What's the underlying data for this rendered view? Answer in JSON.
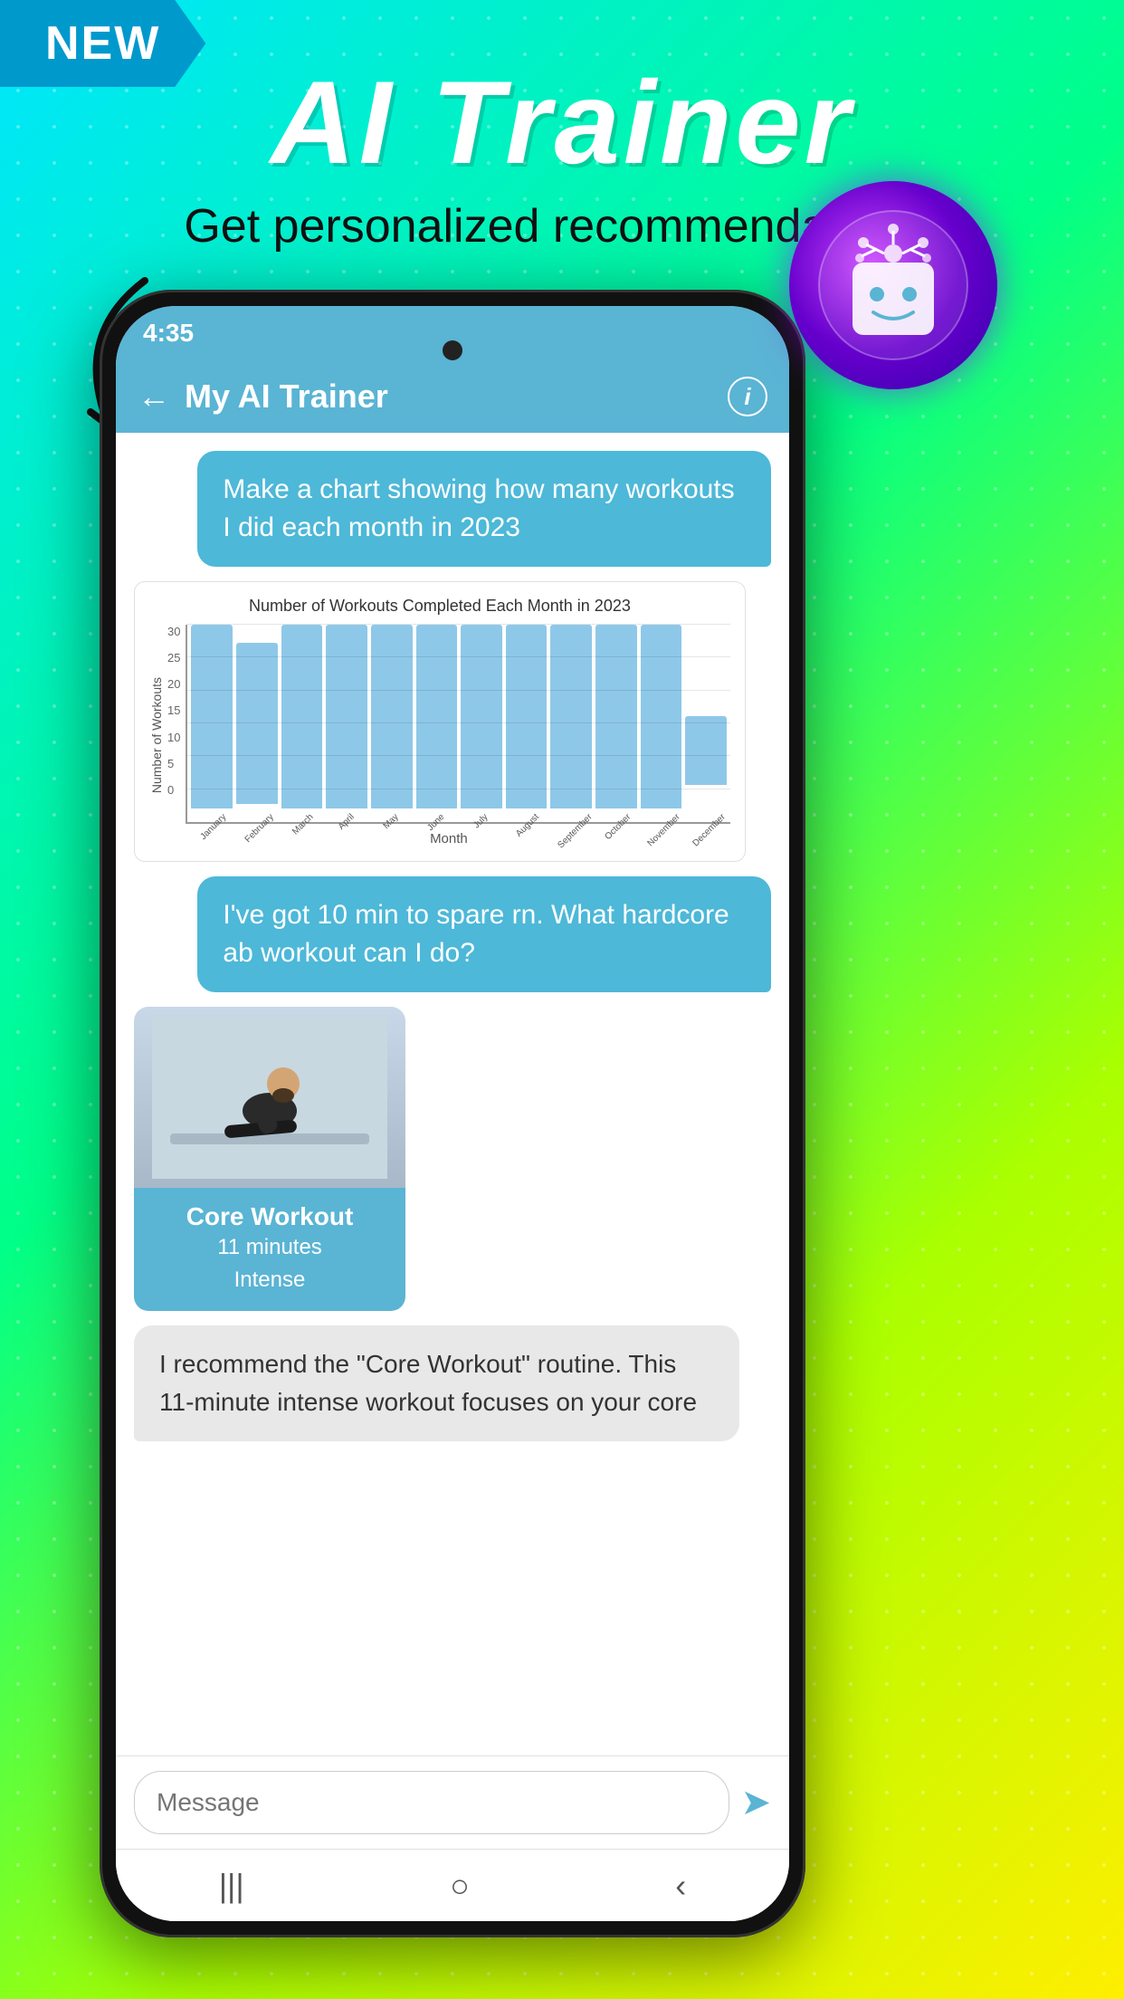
{
  "badge": {
    "text": "NEW"
  },
  "hero": {
    "title": "AI Trainer",
    "subtitle": "Get personalized recommendations!"
  },
  "phone": {
    "status_time": "4:35",
    "header": {
      "title": "My AI Trainer",
      "back_label": "←",
      "info_label": "i"
    },
    "messages": [
      {
        "type": "user",
        "text": "Make a chart showing how many workouts I did each month in 2023"
      },
      {
        "type": "chart",
        "title": "Number of Workouts Completed Each Month in 2023",
        "y_axis_label": "Number of Workouts",
        "x_axis_label": "Month",
        "y_labels": [
          "0",
          "5",
          "10",
          "15",
          "20",
          "25",
          "30"
        ],
        "months": [
          "January",
          "February",
          "March",
          "April",
          "May",
          "June",
          "July",
          "August",
          "September",
          "October",
          "November",
          "December"
        ],
        "values": [
          30,
          27,
          30,
          30,
          30,
          30,
          30,
          30,
          30,
          30,
          30,
          13
        ]
      },
      {
        "type": "user",
        "text": "I've got 10 min to spare rn. What hardcore ab workout can I do?"
      },
      {
        "type": "workout_card",
        "name": "Core Workout",
        "duration": "11 minutes",
        "intensity": "Intense"
      },
      {
        "type": "ai",
        "text": "I recommend the \"Core Workout\" routine. This 11-minute intense workout focuses on your core"
      }
    ],
    "input_placeholder": "Message",
    "send_icon": "➤",
    "nav_icons": [
      "|||",
      "○",
      "<"
    ]
  }
}
